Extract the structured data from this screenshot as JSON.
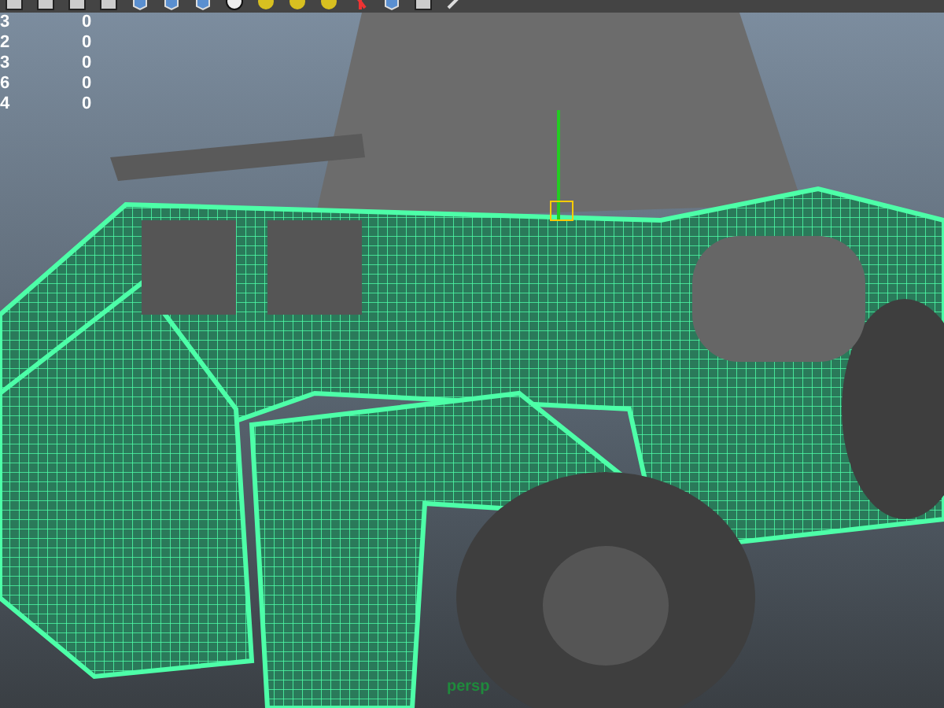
{
  "toolbar": {
    "icons": [
      {
        "kind": "frame"
      },
      {
        "kind": "frame"
      },
      {
        "kind": "frame"
      },
      {
        "kind": "frame"
      },
      {
        "kind": "cube"
      },
      {
        "kind": "cube"
      },
      {
        "kind": "cube"
      },
      {
        "kind": "ball"
      },
      {
        "kind": "sphere"
      },
      {
        "kind": "sphere"
      },
      {
        "kind": "sphere"
      },
      {
        "kind": "light"
      },
      {
        "kind": "cube"
      },
      {
        "kind": "frame"
      },
      {
        "kind": "tool"
      }
    ]
  },
  "hud_rows": [
    {
      "label": "3",
      "value": "0"
    },
    {
      "label": "2",
      "value": "0"
    },
    {
      "label": "3",
      "value": "0"
    },
    {
      "label": "6",
      "value": "0"
    },
    {
      "label": "4",
      "value": "0"
    }
  ],
  "camera_label": "persp"
}
